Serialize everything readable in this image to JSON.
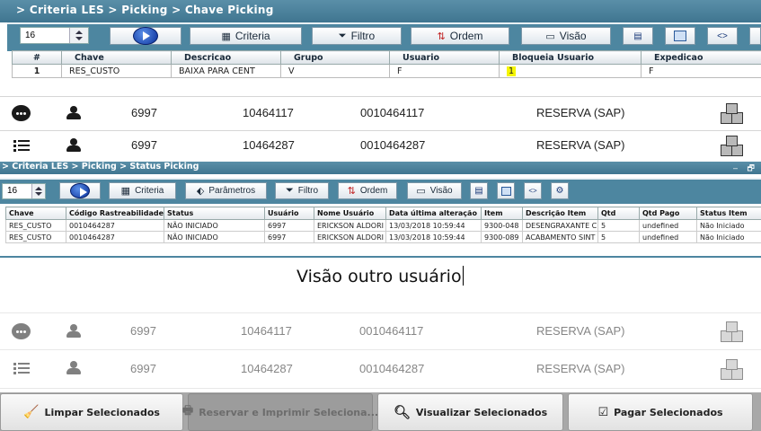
{
  "panel1": {
    "breadcrumb": "> Criteria LES > Picking > Chave Picking",
    "spin_value": "16",
    "buttons": {
      "criteria": "Criteria",
      "filtro": "Filtro",
      "ordem": "Ordem",
      "visao": "Visão"
    },
    "columns": [
      "#",
      "Chave",
      "Descricao",
      "Grupo",
      "Usuario",
      "Bloqueia Usuario",
      "Expedicao"
    ],
    "row": {
      "num": "1",
      "chave": "RES_CUSTO",
      "descricao": "BAIXA PARA CENT",
      "grupo": "V",
      "usuario": "F",
      "bloqueia": "1",
      "expedicao": "F"
    }
  },
  "list_top": [
    {
      "icon": "more-icon",
      "user": "6997",
      "doc1": "10464117",
      "doc2": "0010464117",
      "status": "RESERVA (SAP)"
    },
    {
      "icon": "list-icon",
      "user": "6997",
      "doc1": "10464287",
      "doc2": "0010464287",
      "status": "RESERVA (SAP)"
    }
  ],
  "panel2": {
    "breadcrumb": "> Criteria LES > Picking > Status Picking",
    "window_controls": "– 🗗",
    "spin_value": "16",
    "buttons": {
      "criteria": "Criteria",
      "parametros": "Parâmetros",
      "filtro": "Filtro",
      "ordem": "Ordem",
      "visao": "Visão"
    },
    "columns": [
      "Chave",
      "Código Rastreabilidade",
      "Status",
      "Usuário",
      "Nome Usuário",
      "Data última alteração",
      "Item",
      "Descrição Item",
      "Qtd",
      "Qtd Pago",
      "Status Item"
    ],
    "rows": [
      [
        "RES_CUSTO",
        "0010464287",
        "NÃO INICIADO",
        "6997",
        "ERICKSON ALDORI",
        "13/03/2018 10:59:44",
        "9300-048",
        "DESENGRAXANTE C",
        "5",
        "undefined",
        "Não Iniciado"
      ],
      [
        "RES_CUSTO",
        "0010464287",
        "NÃO INICIADO",
        "6997",
        "ERICKSON ALDORI",
        "13/03/2018 10:59:44",
        "9300-089",
        "ACABAMENTO SINT",
        "5",
        "undefined",
        "Não Iniciado"
      ]
    ]
  },
  "caption": "Visão outro usuário",
  "list_bottom": [
    {
      "icon": "more-icon",
      "user": "6997",
      "doc1": "10464117",
      "doc2": "0010464117",
      "status": "RESERVA (SAP)"
    },
    {
      "icon": "list-icon",
      "user": "6997",
      "doc1": "10464287",
      "doc2": "0010464287",
      "status": "RESERVA (SAP)"
    }
  ],
  "bottom_buttons": {
    "limpar": "Limpar Selecionados",
    "reservar": "Reservar e Imprimir Seleciona...",
    "visualizar": "Visualizar Selecionados",
    "pagar": "Pagar Selecionados"
  }
}
